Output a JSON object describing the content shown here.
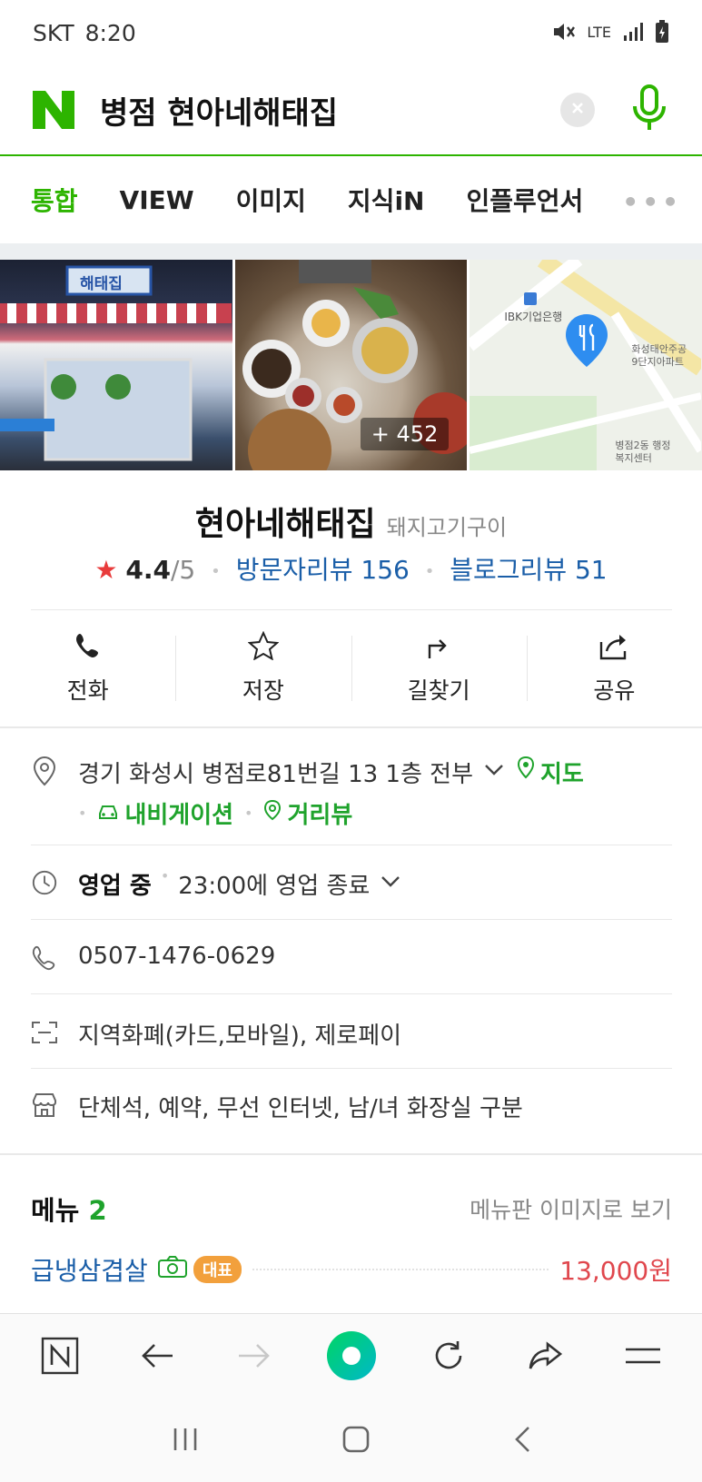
{
  "status_bar": {
    "carrier": "SKT",
    "time": "8:20",
    "network": "LTE"
  },
  "search": {
    "query": "병점 현아네해태집",
    "logo_letter": "N"
  },
  "tabs": [
    {
      "label": "통합",
      "active": true
    },
    {
      "label": "VIEW",
      "active": false
    },
    {
      "label": "이미지",
      "active": false
    },
    {
      "label": "지식iN",
      "active": false
    },
    {
      "label": "인플루언서",
      "active": false
    }
  ],
  "tabs_more": "•••",
  "photos": {
    "count_label": "+ 452",
    "storefront_sign": "해태집",
    "map_labels": {
      "bank": "IBK기업은행",
      "apartment": "화성태안주공 9단지아파트",
      "office": "병점2동 행정복지센터"
    }
  },
  "place": {
    "name": "현아네해태집",
    "category": "돼지고기구이",
    "star": "★",
    "rating": "4.4",
    "rating_max": "/5",
    "visitor_reviews": "방문자리뷰 156",
    "blog_reviews": "블로그리뷰 51"
  },
  "actions": [
    {
      "label": "전화",
      "icon": "phone-icon"
    },
    {
      "label": "저장",
      "icon": "star-icon"
    },
    {
      "label": "길찾기",
      "icon": "directions-icon"
    },
    {
      "label": "공유",
      "icon": "share-icon"
    }
  ],
  "info": {
    "address": "경기 화성시 병점로81번길 13 1층 전부",
    "map_link": "지도",
    "navi_link": "내비게이션",
    "street_link": "거리뷰",
    "status": "영업 중",
    "hours": "23:00에 영업 종료",
    "phone": "0507-1476-0629",
    "payment": "지역화폐(카드,모바일), 제로페이",
    "facilities": "단체석, 예약, 무선 인터넷, 남/녀 화장실 구분"
  },
  "menu": {
    "title": "메뉴",
    "count": "2",
    "view_link": "메뉴판 이미지로 보기",
    "items": [
      {
        "name": "급냉삼겹살",
        "badge": "대표",
        "price": "13,000원"
      }
    ]
  },
  "colors": {
    "naver_green": "#2db400",
    "link_blue": "#1a5ea8",
    "price_red": "#e0474d",
    "badge_orange": "#f2a03c"
  }
}
